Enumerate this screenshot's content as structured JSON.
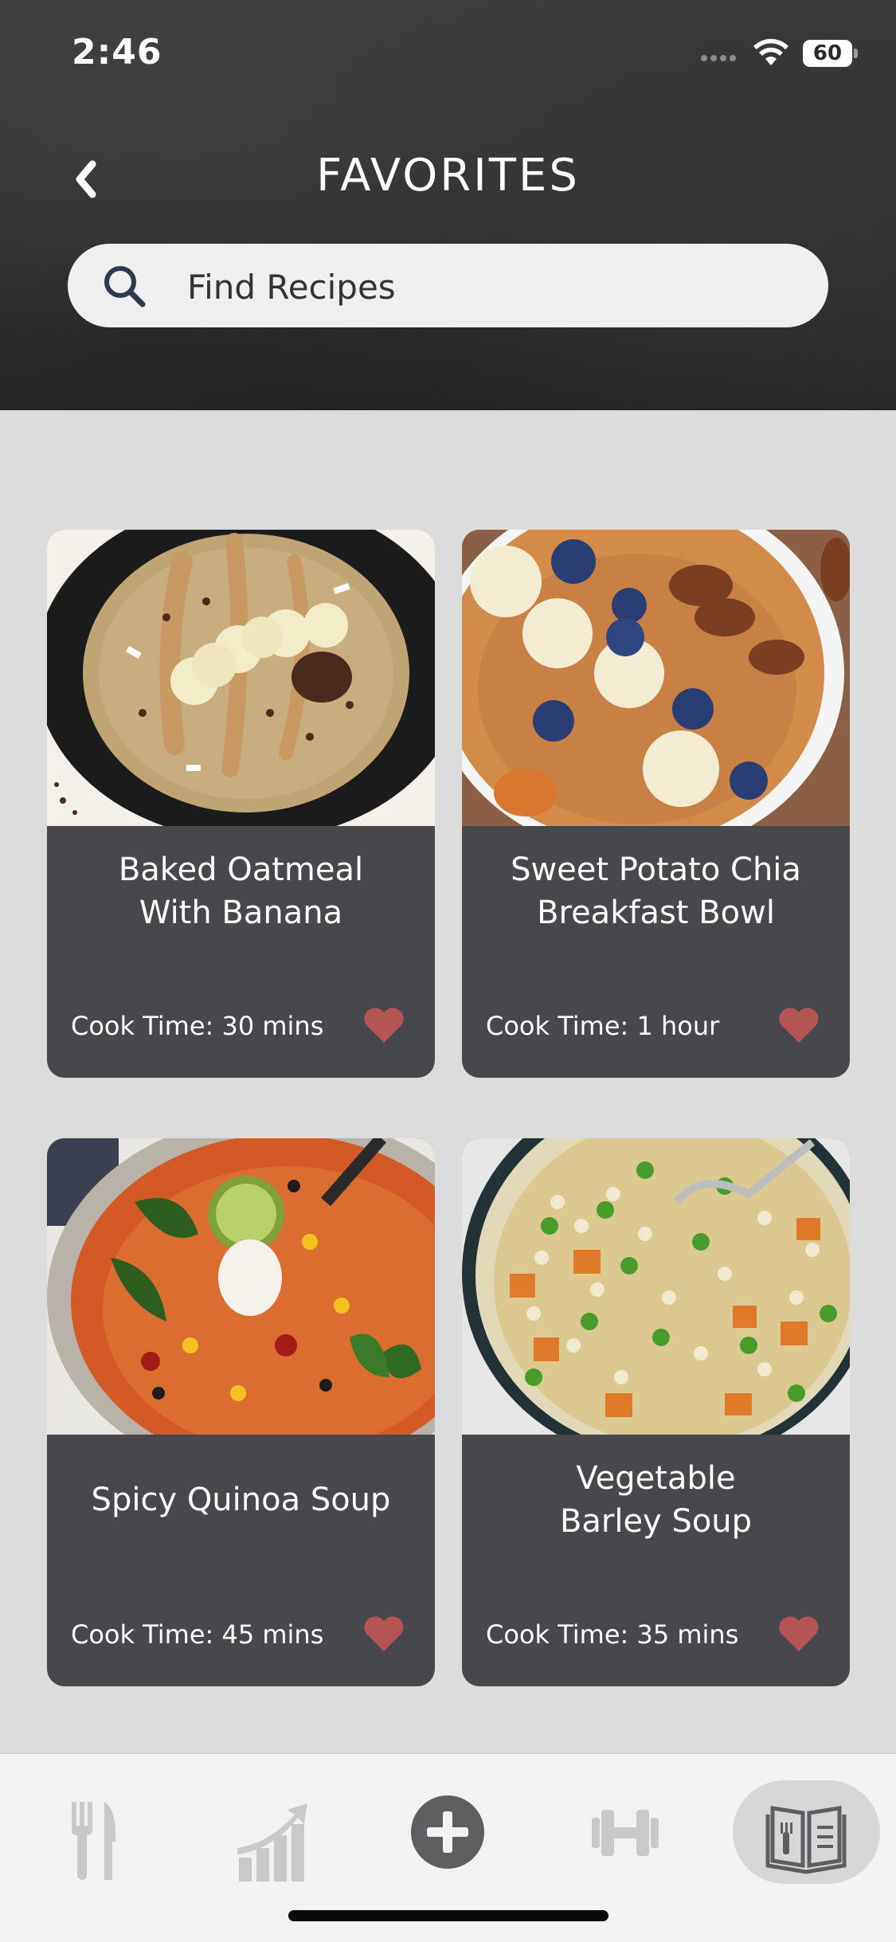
{
  "status_bar": {
    "time": "2:46",
    "battery": "60"
  },
  "header": {
    "title": "FAVORITES"
  },
  "search": {
    "placeholder": "Find Recipes"
  },
  "recipes": [
    {
      "title_line1": "Baked Oatmeal",
      "title_line2": "With Banana",
      "cook_time": "Cook Time: 30 mins",
      "favorited": true
    },
    {
      "title_line1": "Sweet Potato Chia",
      "title_line2": "Breakfast Bowl",
      "cook_time": "Cook Time: 1 hour",
      "favorited": true
    },
    {
      "title_line1": "Spicy Quinoa Soup",
      "title_line2": "",
      "cook_time": "Cook Time: 45 mins",
      "favorited": true
    },
    {
      "title_line1": "Vegetable",
      "title_line2": "Barley Soup",
      "cook_time": "Cook Time: 35 mins",
      "favorited": true
    }
  ],
  "tab_bar": {
    "tabs": [
      "fork-knife-icon",
      "progress-chart-icon",
      "plus-icon",
      "dumbbell-icon",
      "recipe-book-icon"
    ],
    "active": "recipe-book-icon"
  },
  "colors": {
    "accent_heart": "#b55454",
    "card_bg": "#48484c",
    "page_bg": "#dcdcdd",
    "tab_icon": "#c9c9c9",
    "tab_active_icon": "#5e5e60"
  }
}
